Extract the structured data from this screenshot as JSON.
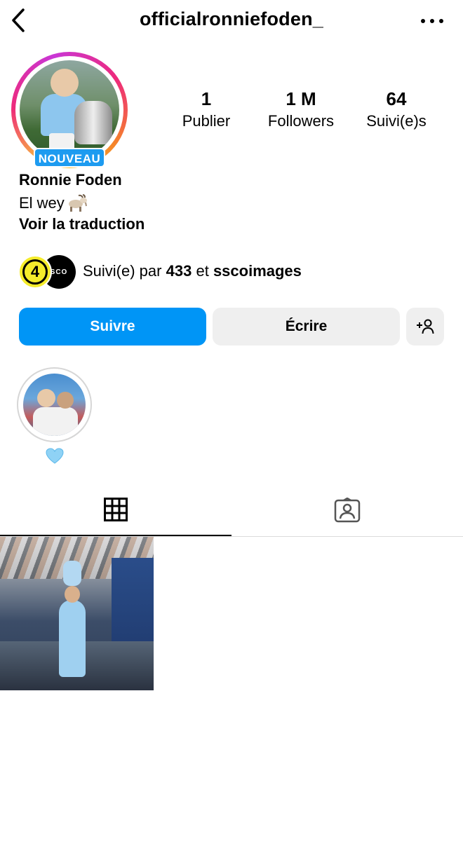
{
  "header": {
    "username": "officialronniefoden_"
  },
  "profile": {
    "badge": "NOUVEAU",
    "name": "Ronnie Foden",
    "bio": "El wey",
    "bio_emoji": "goat",
    "translate_link": "Voir la traduction"
  },
  "stats": [
    {
      "value": "1",
      "label": "Publier"
    },
    {
      "value": "1 M",
      "label": "Followers"
    },
    {
      "value": "64",
      "label": "Suivi(e)s"
    }
  ],
  "followed_by": {
    "prefix": "Suivi(e) par",
    "count": "433",
    "joiner": "et",
    "account": "sscoimages",
    "avatar1_text": "4",
    "avatar2_text": "SCO"
  },
  "actions": {
    "follow": "Suivre",
    "message": "Écrire",
    "add_user_icon": "person-add-icon"
  },
  "highlights": [
    {
      "label_emoji": "💙",
      "label_icon": "blue-heart-icon"
    }
  ],
  "tabs": [
    {
      "name": "grid",
      "icon": "grid-icon",
      "active": true
    },
    {
      "name": "tagged",
      "icon": "tagged-icon",
      "active": false
    }
  ],
  "posts_count_visible": 1,
  "colors": {
    "follow_button": "#0095f6",
    "secondary_button": "#efefef",
    "badge": "#1d9bf0",
    "text": "#000000"
  }
}
